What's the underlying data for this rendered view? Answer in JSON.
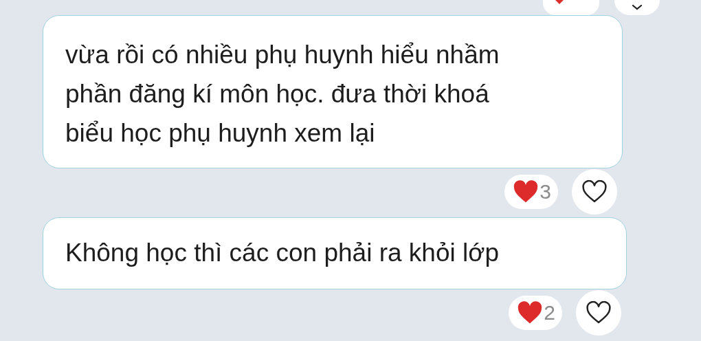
{
  "messages": [
    {
      "text": "vừa rồi có nhiều phụ huynh hiểu nhầm\nphần đăng kí môn học. đưa thời khoá\nbiểu học phụ huynh xem lại",
      "reaction": {
        "kind": "heart",
        "count": "3"
      },
      "liked": false
    },
    {
      "text": "Không học thì các con phải ra khỏi lớp",
      "reaction": {
        "kind": "heart",
        "count": "2"
      },
      "liked": false
    }
  ]
}
